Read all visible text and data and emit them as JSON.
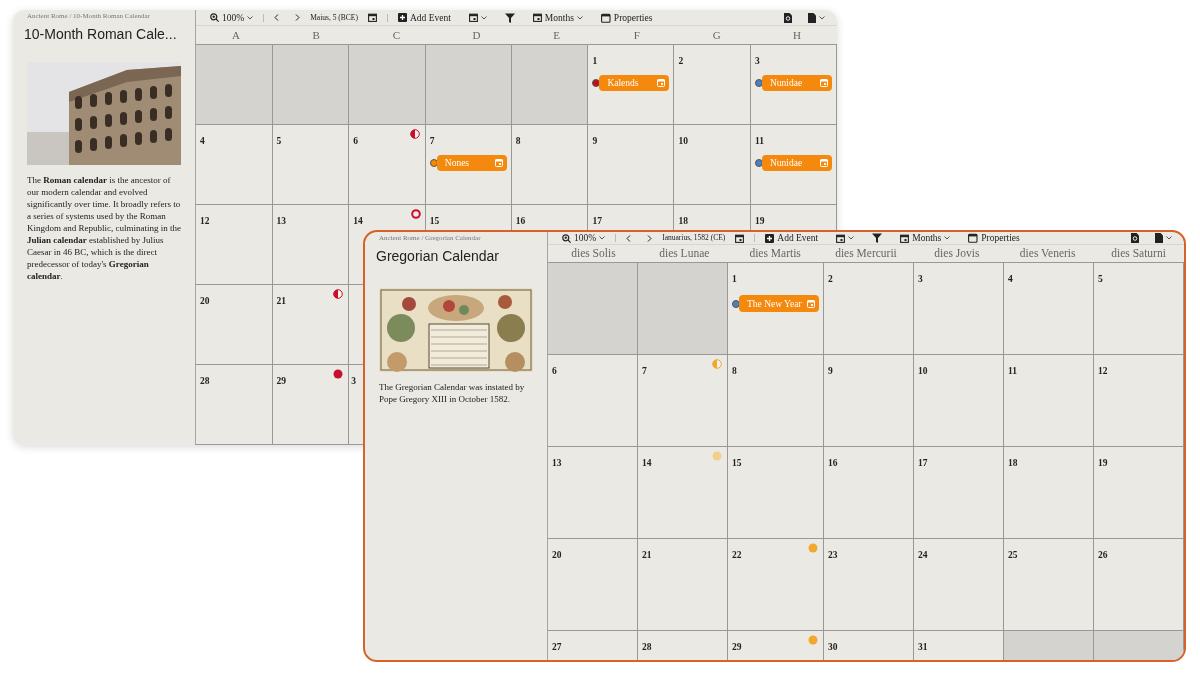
{
  "windows": [
    {
      "focused": false,
      "breadcrumb": "Ancient Rome / 10-Month Roman Calendar",
      "title": "10-Month Roman Cale...",
      "image": {
        "kind": "picture"
      },
      "description": "The **Roman calendar** is the ancestor of our modern calendar and evolved significantly over time. It broadly refers to a series of systems used by the Roman Kingdom and Republic, culminating in the **Julian calendar** established by Julius Caesar in 46 BC, which is the direct predecessor of today's **Gregorian calendar**.",
      "toolbar": {
        "zoom": "100%",
        "date": "Maius, 5 (BCE)",
        "add_event": "Add Event",
        "view": "Months",
        "properties": "Properties"
      },
      "columns": [
        "A",
        "B",
        "C",
        "D",
        "E",
        "F",
        "G",
        "H"
      ],
      "weeks": [
        [
          {
            "kind": "blank"
          },
          {
            "kind": "blank"
          },
          {
            "kind": "blank"
          },
          {
            "kind": "blank"
          },
          {
            "kind": "blank"
          },
          {
            "kind": "day",
            "day": "1",
            "events": [
              {
                "label": "Kalends",
                "color": "#c0101a"
              }
            ]
          },
          {
            "kind": "day",
            "day": "2"
          },
          {
            "kind": "day",
            "day": "3",
            "events": [
              {
                "label": "Nunidae",
                "color": "#4a7fc0"
              }
            ]
          }
        ],
        [
          {
            "kind": "day",
            "day": "4"
          },
          {
            "kind": "day",
            "day": "5"
          },
          {
            "kind": "day",
            "day": "6",
            "moon": {
              "kind": "half",
              "color": "#c8102e"
            }
          },
          {
            "kind": "day",
            "day": "7",
            "events": [
              {
                "label": "Nones",
                "color": "#f08a00"
              }
            ]
          },
          {
            "kind": "day",
            "day": "8"
          },
          {
            "kind": "day",
            "day": "9"
          },
          {
            "kind": "day",
            "day": "10"
          },
          {
            "kind": "day",
            "day": "11",
            "events": [
              {
                "label": "Nunidae",
                "color": "#4a7fc0"
              }
            ]
          }
        ],
        [
          {
            "kind": "day",
            "day": "12"
          },
          {
            "kind": "day",
            "day": "13"
          },
          {
            "kind": "day",
            "day": "14",
            "moon": {
              "kind": "ring",
              "color": "#c8102e"
            }
          },
          {
            "kind": "day",
            "day": "15"
          },
          {
            "kind": "day",
            "day": "16"
          },
          {
            "kind": "day",
            "day": "17"
          },
          {
            "kind": "day",
            "day": "18"
          },
          {
            "kind": "day",
            "day": "19"
          }
        ],
        [
          {
            "kind": "day",
            "day": "20"
          },
          {
            "kind": "day",
            "day": "21",
            "moon": {
              "kind": "half",
              "color": "#c8102e"
            }
          }
        ],
        [
          {
            "kind": "day",
            "day": "28"
          },
          {
            "kind": "day",
            "day": "29",
            "moon": {
              "kind": "full",
              "color": "#c8102e"
            }
          },
          {
            "kind": "day",
            "day": "3"
          }
        ]
      ]
    },
    {
      "focused": true,
      "breadcrumb": "Ancient Rome / Gregorian Calendar",
      "title": "Gregorian Calendar",
      "image": {
        "kind": "picture"
      },
      "description": "The Gregorian Calendar was instated by Pope Gregory XIII in October 1582.",
      "toolbar": {
        "zoom": "100%",
        "date": "Ianuarius, 1582 (CE)",
        "add_event": "Add Event",
        "view": "Months",
        "properties": "Properties"
      },
      "columns": [
        "dies Solis",
        "dies Lunae",
        "dies Martis",
        "dies Mercurii",
        "dies Jovis",
        "dies Veneris",
        "dies Saturni"
      ],
      "weeks": [
        [
          {
            "kind": "blank"
          },
          {
            "kind": "blank"
          },
          {
            "kind": "day",
            "day": "1",
            "events": [
              {
                "label": "The New Year",
                "color": "#4a7fc0"
              }
            ]
          },
          {
            "kind": "day",
            "day": "2"
          },
          {
            "kind": "day",
            "day": "3"
          },
          {
            "kind": "day",
            "day": "4"
          },
          {
            "kind": "day",
            "day": "5"
          }
        ],
        [
          {
            "kind": "day",
            "day": "6"
          },
          {
            "kind": "day",
            "day": "7",
            "moon": {
              "kind": "half",
              "color": "#f0a830"
            }
          },
          {
            "kind": "day",
            "day": "8"
          },
          {
            "kind": "day",
            "day": "9"
          },
          {
            "kind": "day",
            "day": "10"
          },
          {
            "kind": "day",
            "day": "11"
          },
          {
            "kind": "day",
            "day": "12"
          }
        ],
        [
          {
            "kind": "day",
            "day": "13"
          },
          {
            "kind": "day",
            "day": "14",
            "moon": {
              "kind": "full",
              "color": "#f3cf8e"
            }
          },
          {
            "kind": "day",
            "day": "15"
          },
          {
            "kind": "day",
            "day": "16"
          },
          {
            "kind": "day",
            "day": "17"
          },
          {
            "kind": "day",
            "day": "18"
          },
          {
            "kind": "day",
            "day": "19"
          }
        ],
        [
          {
            "kind": "day",
            "day": "20"
          },
          {
            "kind": "day",
            "day": "21"
          },
          {
            "kind": "day",
            "day": "22",
            "moon": {
              "kind": "full",
              "color": "#f0a830"
            }
          },
          {
            "kind": "day",
            "day": "23"
          },
          {
            "kind": "day",
            "day": "24"
          },
          {
            "kind": "day",
            "day": "25"
          },
          {
            "kind": "day",
            "day": "26"
          }
        ],
        [
          {
            "kind": "day",
            "day": "27"
          },
          {
            "kind": "day",
            "day": "28"
          },
          {
            "kind": "day",
            "day": "29",
            "moon": {
              "kind": "full",
              "color": "#f0a830"
            }
          },
          {
            "kind": "day",
            "day": "30"
          },
          {
            "kind": "day",
            "day": "31"
          },
          {
            "kind": "blank"
          },
          {
            "kind": "blank"
          }
        ]
      ]
    }
  ]
}
